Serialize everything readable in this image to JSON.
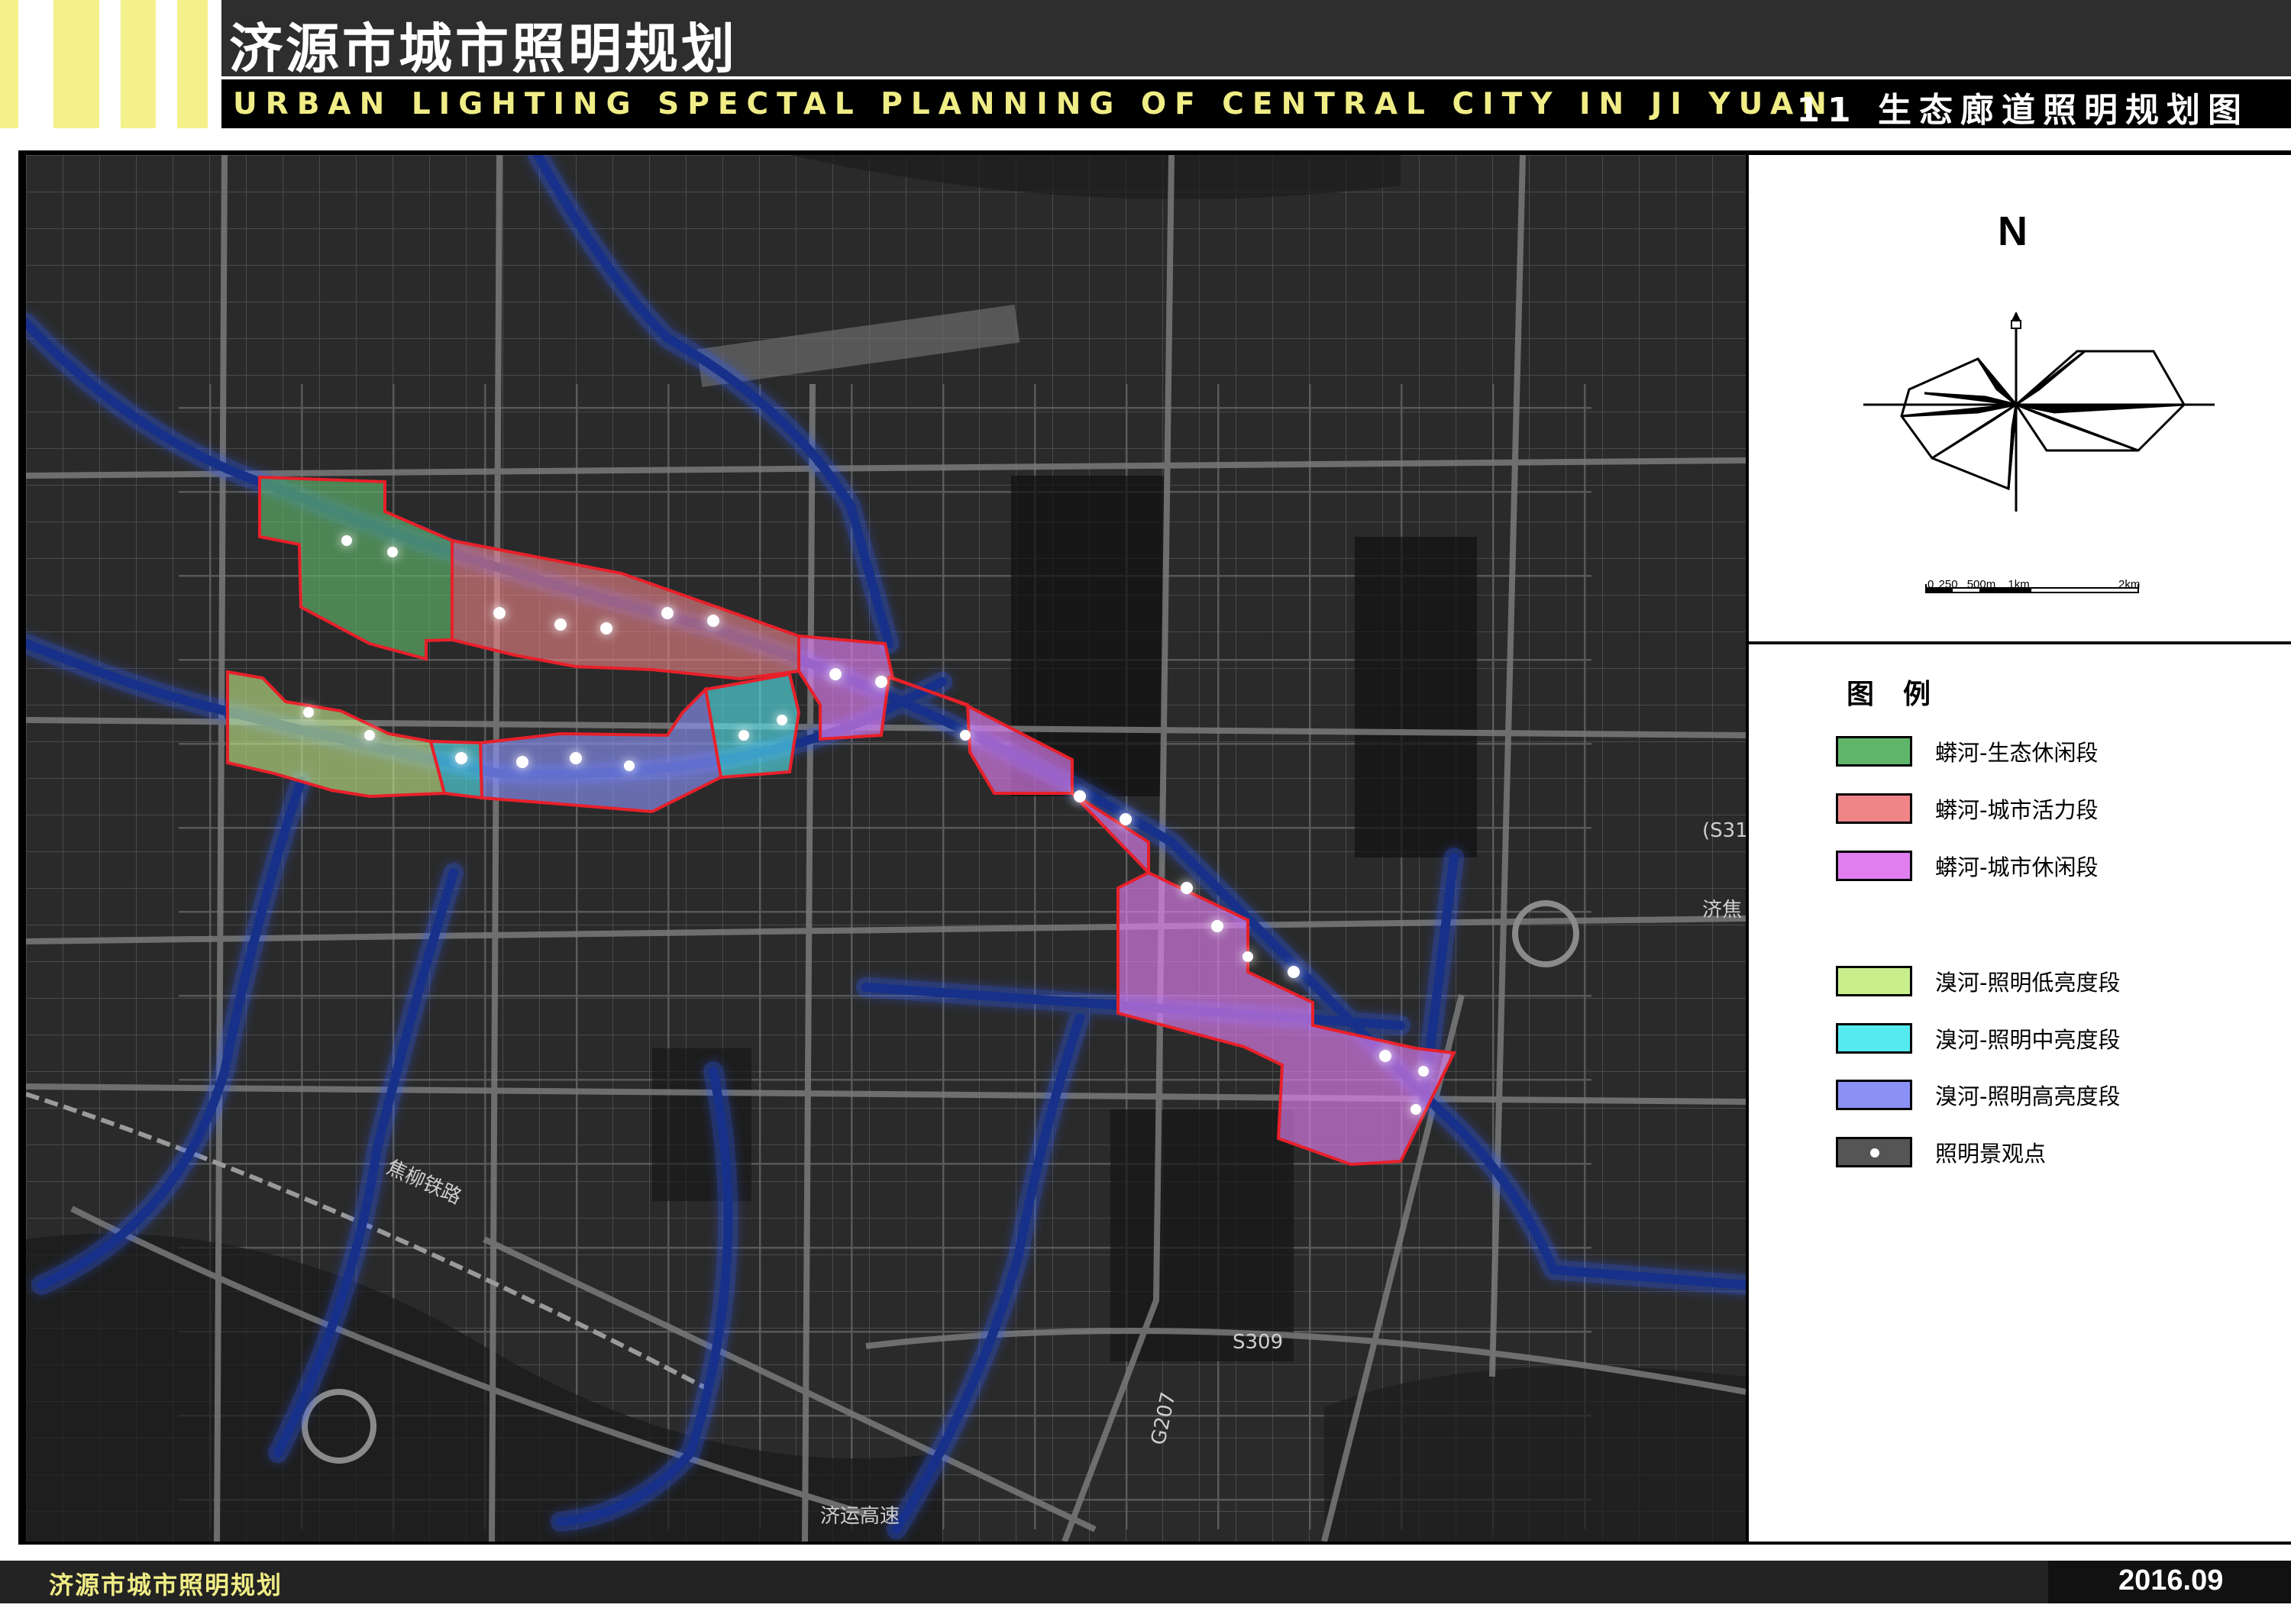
{
  "header": {
    "title": "济源市城市照明规划",
    "subtitle_en": "URBAN LIGHTING SPECTAL PLANNING OF CENTRAL CITY IN JI YUAN",
    "sheet_title": "11 生态廊道照明规划图"
  },
  "map": {
    "labels": {
      "railway": "焦柳铁路",
      "expressway": "济运高速",
      "road_s309": "S309",
      "road_g207": "G207",
      "road_s31": "(S31",
      "east_road": "济焦"
    },
    "colors": {
      "background": "#2a2a2a",
      "roads": "#5a5a5a",
      "river": "#1d3a9e",
      "river_glow": "#2f5cff"
    }
  },
  "panel": {
    "north": "N",
    "scale": {
      "t0": "0",
      "t1": "250",
      "t2": "500m",
      "t3": "1km",
      "t4": "2km"
    }
  },
  "legend": {
    "title": "图例",
    "items": [
      {
        "label": "蟒河-生态休闲段",
        "color": "#5fb66a"
      },
      {
        "label": "蟒河-城市活力段",
        "color": "#f08588"
      },
      {
        "label": "蟒河-城市休闲段",
        "color": "#e07ef0"
      },
      {
        "label": "溴河-照明低亮度段",
        "color": "#c8ef8c"
      },
      {
        "label": "溴河-照明中亮度段",
        "color": "#55eaf0"
      },
      {
        "label": "溴河-照明高亮度段",
        "color": "#8a90f4"
      },
      {
        "label": "照明景观点",
        "color": "#555555"
      }
    ]
  },
  "footer": {
    "left": "济源市城市照明规划",
    "right": "2016.09"
  }
}
